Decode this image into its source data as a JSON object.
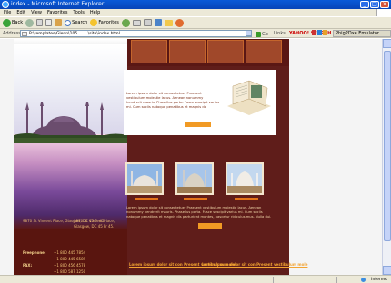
{
  "window": {
    "title": "index - Microsoft Internet Explorer",
    "buttons": [
      "_",
      "□",
      "×"
    ]
  },
  "menu": [
    "File",
    "Edit",
    "View",
    "Favorites",
    "Tools",
    "Help"
  ],
  "toolbar": {
    "back": "Back",
    "search": "Search",
    "favorites": "Favorites"
  },
  "address": {
    "label": "Address",
    "value": "P:\\templates\\Glenn\\105........\\site\\index.html",
    "go": "Go",
    "links": "Links",
    "yahoo": "YAHOO! SEARCH",
    "mp": "",
    "emulator": "Phig2Dxe Emulator"
  },
  "site": {
    "about_text": "Lorem ipsum dolor sit consectetuer Praesent vestibulum molestie lacus. Aenean nonummy hendrerit mauris. Phasellus porta. Fusce suscipit varius mi. Cum sociis natoque penatibus et magnis do",
    "address1": "9870 St Vincent Place, Glasgow, DC 45 Fr 45.",
    "address2": "9870 St Vincent Place, Glasgow, DC 45 Fr 45.",
    "phones": [
      {
        "label": "Freephone:",
        "value": "+1 800 445 7854"
      },
      {
        "label": "",
        "value": "+1 800 445 6589"
      },
      {
        "label": "FAX:",
        "value": "+1 800 456 4578"
      },
      {
        "label": "",
        "value": "+1 800 587 1250"
      }
    ],
    "body_text": "Lorem ipsum dolor sit consectetuer Praesent vestibulum molestie lacus. Aenean nonummy hendrerit mauris. Phasellus porta. Fusce suscipit varius mi. Cum sociis natoque penatibus et magnis dis parturient montes, nascetur ridiculus mus. Nulla dui.",
    "news1": "Lorem ipsum dolor sit con Present vestibulum mole",
    "news2": "Lorem ipsum dolor sit con Present vestibulum mole"
  },
  "status": {
    "zone": "Internet"
  },
  "colors": {
    "maroon": "#5a1714",
    "orange": "#f19a24",
    "ie_blue": "#0a5ad8"
  }
}
